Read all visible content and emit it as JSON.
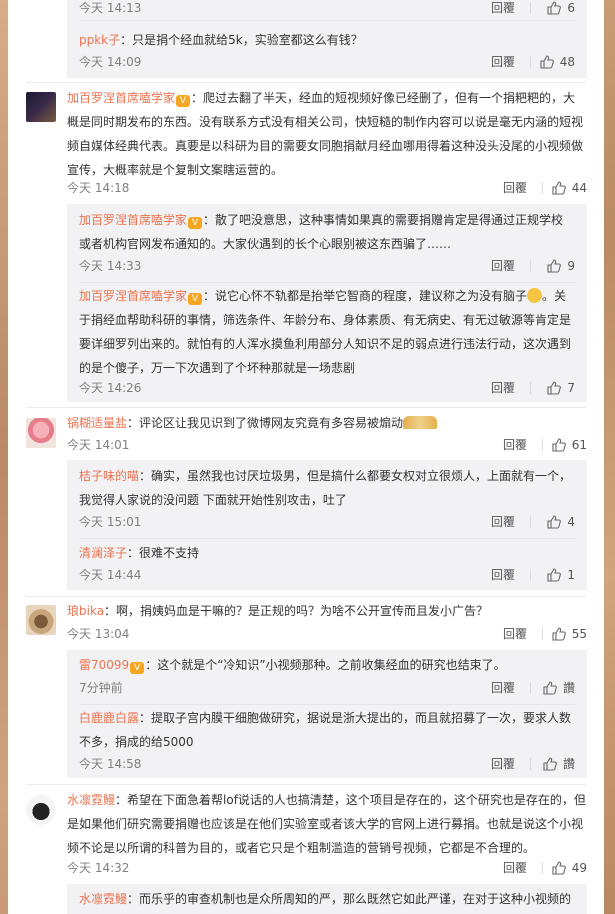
{
  "labels": {
    "reply": "回覆",
    "like_plain": "讚"
  },
  "comments": [
    {
      "subs": [
        {
          "user": "",
          "text": "",
          "time": "今天 14:13",
          "likes": "6"
        },
        {
          "user": "ppkk子",
          "text": "：只是捐个经血就给5k，实验室都这么有钱？",
          "time": "今天 14:09",
          "likes": "48"
        }
      ]
    },
    {
      "user": "加百罗涅首席嗑学家",
      "text": "：爬过去翻了半天，经血的短视频好像已经删了，但有一个捐粑粑的，大概是同时期发布的东西。没有联系方式没有相关公司，快短糙的制作内容可以说是毫无内涵的短视频自媒体经典代表。真要是以科研为目的需要女同胞捐献月经血哪用得着这种没头没尾的小视频做宣传，大概率就是个复制文案瞎运营的。",
      "time": "今天 14:18",
      "likes": "44",
      "subs": [
        {
          "user": "加百罗涅首席嗑学家",
          "text": "：散了吧没意思，这种事情如果真的需要捐赠肯定是得通过正规学校或者机构官网发布通知的。大家伙遇到的长个心眼别被这东西骗了……",
          "time": "今天 14:33",
          "likes": "9"
        },
        {
          "user": "加百罗涅首席嗑学家",
          "text": "：说它心怀不轨都是抬举它智商的程度，建议称之为没有脑子",
          "text2": "。关于捐经血帮助科研的事情，筛选条件、年龄分布、身体素质、有无病史、有无过敏源等肯定是要详细罗列出来的。就怕有的人浑水摸鱼利用部分人知识不足的弱点进行违法行动，这次遇到的是个傻子，万一下次遇到了个坏种那就是一场悲剧",
          "time": "今天 14:26",
          "likes": "7"
        }
      ]
    },
    {
      "user": "锅糊适量盐",
      "text": "：评论区让我见识到了微博网友究竟有多容易被煽动",
      "time": "今天 14:01",
      "likes": "61",
      "subs": [
        {
          "user": "桔子味的喵",
          "text": "：确实，虽然我也讨厌垃圾男，但是搞什么都要女权对立很烦人，上面就有一个，我觉得人家说的没问题 下面就开始性别攻击，吐了",
          "time": "今天 15:01",
          "likes": "4"
        },
        {
          "user": "清澜泽子",
          "text": "：很难不支持",
          "time": "今天 14:44",
          "likes": "1"
        }
      ]
    },
    {
      "user": "琅bika",
      "text": "：啊，捐姨妈血是干嘛的？是正规的吗？为啥不公开宣传而且发小广告？",
      "time": "今天 13:04",
      "likes": "55",
      "subs": [
        {
          "user": "雷70099",
          "text": "：这个就是个“冷知识”小视频那种。之前收集经血的研究也结束了。",
          "time": "7分钟前",
          "likes": ""
        },
        {
          "user": "白鹿鹿白露",
          "text": "：提取子宫内膜干细胞做研究，据说是浙大提出的，而且就招募了一次，要求人数不多，捐成的给5000",
          "time": "今天 14:58",
          "likes": ""
        }
      ]
    },
    {
      "user": "水凛霓鳗",
      "text": "：希望在下面急着帮lof说话的人也搞清楚，这个项目是存在的，这个研究也是存在的，但是如果他们研究需要捐赠也应该是在他们实验室或者该大学的官网上进行募捐。也就是说这个小视频不论是以所谓的科普为目的，或者它只是个粗制滥造的营销号视频，它都是不合理的。",
      "time": "今天 14:32",
      "likes": "49",
      "subs": [
        {
          "user": "水凛霓鳗",
          "text": "：而乐乎的审查机制也是众所周知的严，那么既然它如此严谨，在对于这种小视频的",
          "time": "",
          "likes": ""
        }
      ]
    }
  ]
}
